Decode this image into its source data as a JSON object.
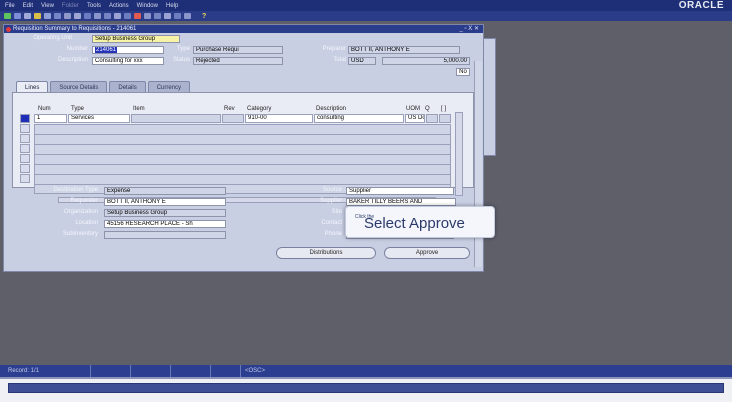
{
  "menu": {
    "items": [
      "File",
      "Edit",
      "View",
      "Folder",
      "Tools",
      "Actions",
      "Window",
      "Help"
    ],
    "brand": "ORACLE"
  },
  "toolbar": {
    "help": "?"
  },
  "window": {
    "title": "Requisition Summary to Requisitions - 214061",
    "controls": "_ ▫ X ✕"
  },
  "header": {
    "operating_unit_label": "Operating Unit",
    "operating_unit": "Setup Business Group",
    "number_label": "Number",
    "number": "214061",
    "type_label": "Type",
    "type": "Purchase Requi",
    "preparer_label": "Preparer",
    "preparer": "BOTT II, ANTHONY E",
    "description_label": "Description",
    "description": "Consulting for xxx",
    "status_label": "Status",
    "status": "Rejected",
    "total_label": "Total",
    "currency": "USD",
    "total": "5,000.00",
    "no_button": "No"
  },
  "tabs": [
    "Lines",
    "Source Details",
    "Details",
    "Currency"
  ],
  "lines": {
    "headers": {
      "num": "Num",
      "type": "Type",
      "item": "Item",
      "rev": "Rev",
      "category": "Category",
      "description": "Description",
      "uom": "UOM",
      "u": "Q",
      "flag": "[ ]"
    },
    "row1": {
      "num": "1",
      "type": "Services",
      "item": "",
      "rev": "",
      "category": "910-00",
      "description": "consulting",
      "uom": "US Do"
    }
  },
  "details": {
    "destination_type_label": "Destination Type",
    "destination_type": "Expense",
    "requester_label": "Requester",
    "requester": "BOTT II, ANTHONY E",
    "organization_label": "Organization",
    "organization": "Setup Business Group",
    "location_label": "Location",
    "location": "45156 RESEARCH PLACE - Sh",
    "subinventory_label": "Subinventory",
    "source_label": "Source",
    "source": "Supplier",
    "supplier_label": "Supplier",
    "supplier": "BAKER TILLY BEERS AND",
    "site_label": "Site",
    "contact_label": "Contact",
    "phone_label": "Phone"
  },
  "buttons": {
    "distributions": "Distributions",
    "approve": "Approve"
  },
  "callout": {
    "small": "Click the",
    "big": "Select Approve"
  },
  "statusbar": {
    "record": "Record: 1/1",
    "osc": "<OSC>"
  }
}
